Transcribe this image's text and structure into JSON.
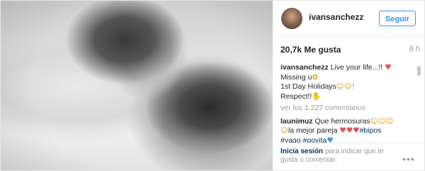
{
  "post": {
    "username": "ivansanchezz",
    "follow_label": "Seguir",
    "likes": "20,7k Me gusta",
    "time": "8 h"
  },
  "caption": {
    "user": "ivansanchezz",
    "line1": "Live your life...!!",
    "line2": "Missing u",
    "line3": "1st Day Holidays",
    "line4": "Respect!!"
  },
  "view_more": "ver los 1.227 comentarios",
  "comment1": {
    "user": "launimuz",
    "text1": "Que hermosuras",
    "text2": "la mejor pareja",
    "tag1": "#bipos",
    "tag2": "#yago",
    "tag3": "#goyita"
  },
  "footer": {
    "login_label": "Inicia sesión",
    "login_rest": "para indicar que te gusta o comentar.",
    "more_label": "•••"
  },
  "icons": {
    "heart": "heart-icon",
    "more": "ellipsis-icon"
  }
}
